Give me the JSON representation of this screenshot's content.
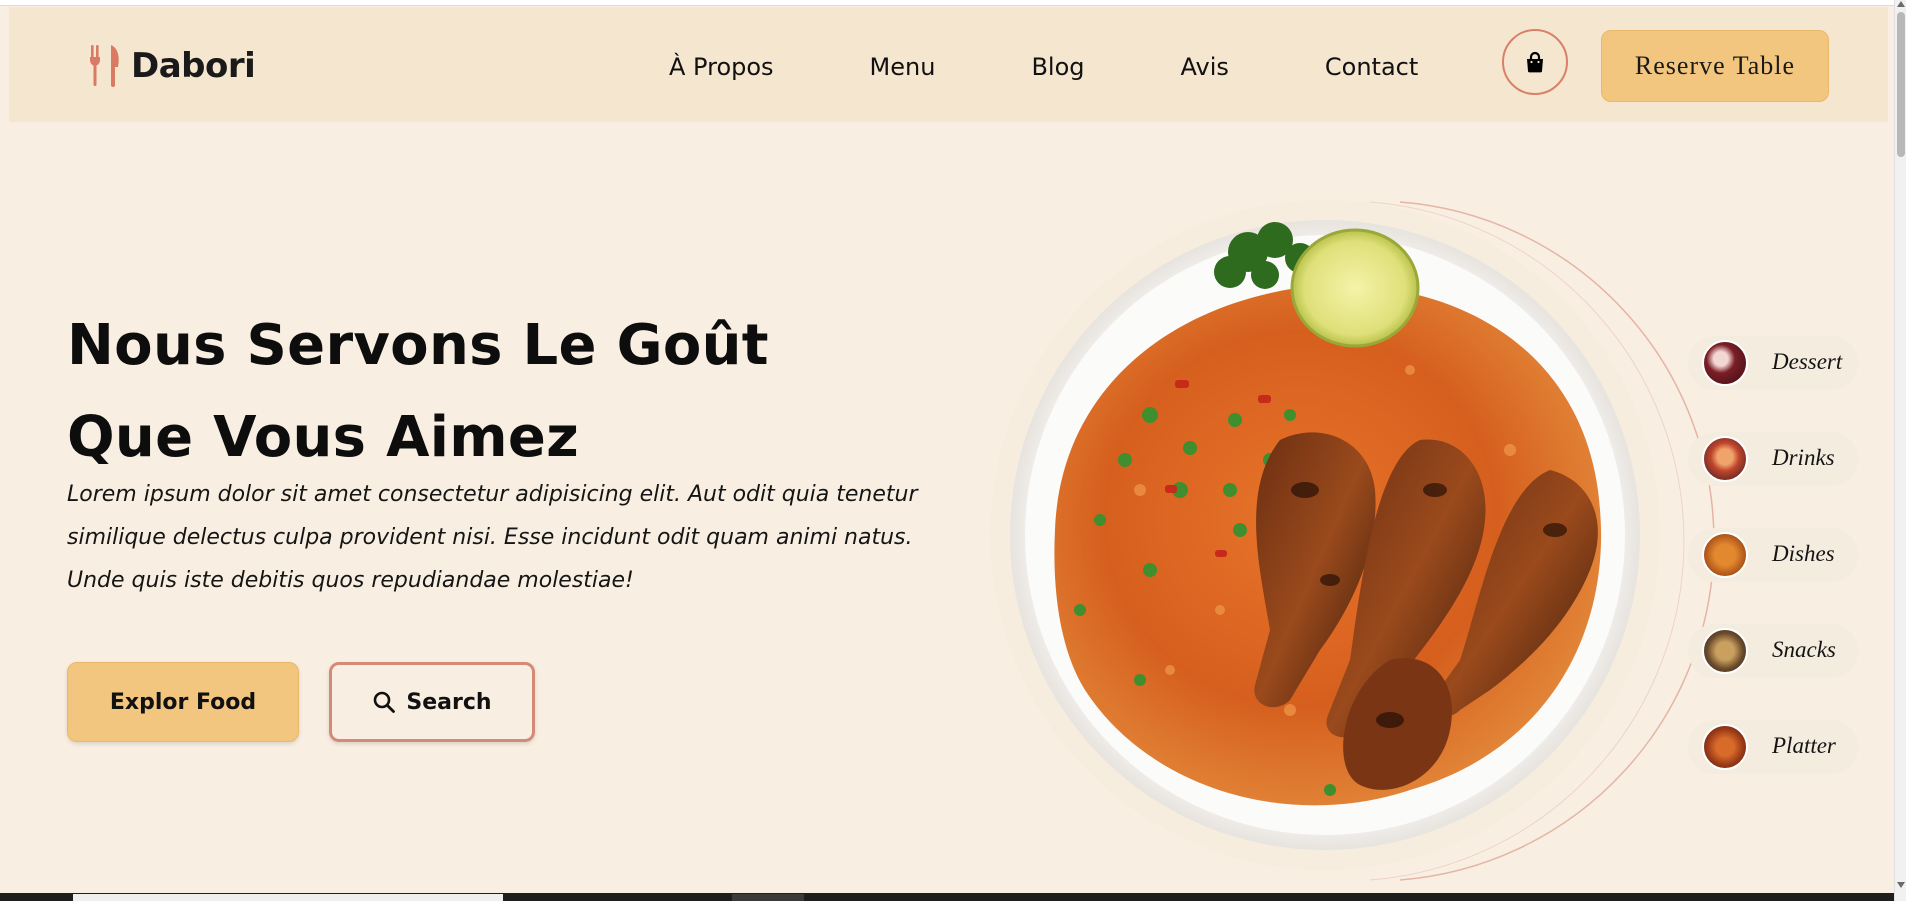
{
  "brand": {
    "name": "Dabori",
    "icon": "utensils-icon"
  },
  "nav": {
    "links": [
      "À Propos",
      "Menu",
      "Blog",
      "Avis",
      "Contact"
    ],
    "cart_icon": "shopping-bag-icon",
    "reserve_label": "Reserve Table"
  },
  "hero": {
    "title_line1": "Nous Servons Le Goût",
    "title_line2": "Que Vous Aimez",
    "description": "Lorem ipsum dolor sit amet consectetur adipisicing elit. Aut odit quia tenetur similique delectus culpa provident nisi. Esse incidunt odit quam animi natus. Unde quis iste debitis quos repudiandae molestiae!",
    "explore_label": "Explor Food",
    "search_label": "Search",
    "search_icon": "search-icon",
    "image": "jollof-rice-chicken-plate"
  },
  "categories": [
    {
      "label": "Dessert",
      "thumb": "dessert-thumbnail"
    },
    {
      "label": "Drinks",
      "thumb": "drinks-thumbnail"
    },
    {
      "label": "Dishes",
      "thumb": "dishes-thumbnail"
    },
    {
      "label": "Snacks",
      "thumb": "snacks-thumbnail"
    },
    {
      "label": "Platter",
      "thumb": "platter-thumbnail"
    }
  ],
  "colors": {
    "page_bg": "#f8efe2",
    "nav_bg": "#f5e6cf",
    "accent": "#f2c67e",
    "outline": "#d58a78",
    "brand_icon": "#d97a63"
  }
}
